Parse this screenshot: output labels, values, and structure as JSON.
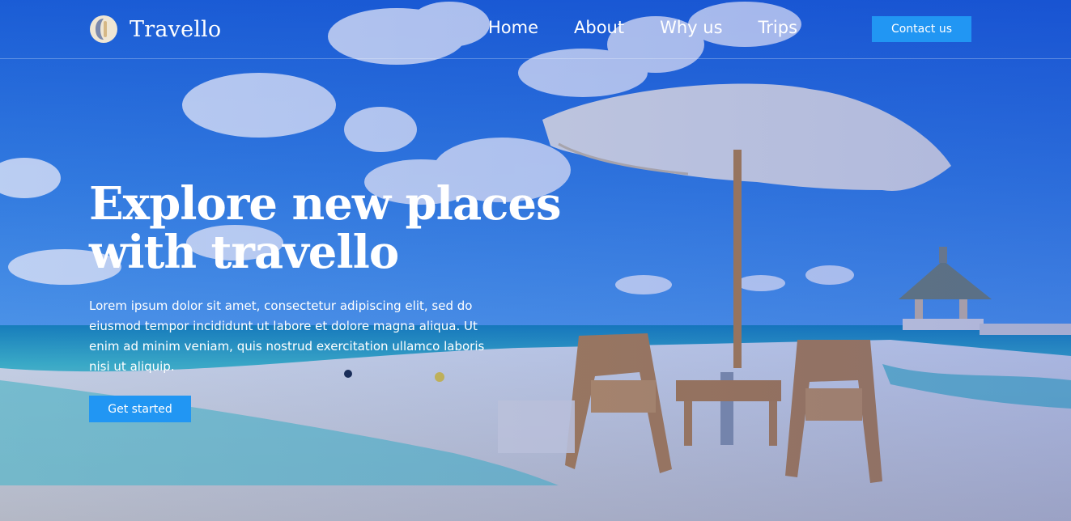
{
  "brand": {
    "name": "Travello",
    "logo_icon": "travello-logo-icon"
  },
  "nav": {
    "items": [
      {
        "label": "Home"
      },
      {
        "label": "About"
      },
      {
        "label": "Why us"
      },
      {
        "label": "Trips"
      }
    ],
    "contact_label": "Contact us"
  },
  "hero": {
    "headline_line1": "Explore new places",
    "headline_line2": "with travello",
    "description": "Lorem ipsum dolor sit amet, consectetur adipiscing elit, sed do eiusmod tempor incididunt ut labore et dolore magna aliqua. Ut enim ad minim veniam, quis nostrud exercitation ullamco laboris nisi ut aliquip.",
    "cta_label": "Get started"
  },
  "colors": {
    "accent": "#2196f3",
    "overlay": "#0a3fd6",
    "text": "#ffffff"
  }
}
